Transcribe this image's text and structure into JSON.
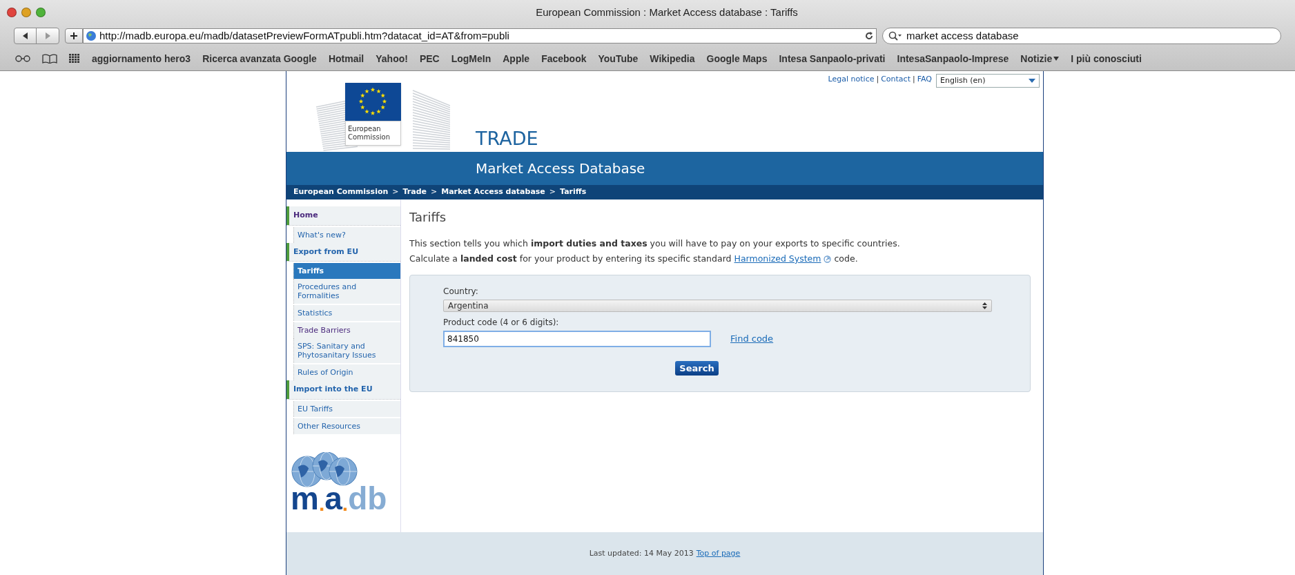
{
  "browser": {
    "title": "European Commission : Market Access database : Tariffs",
    "url": "http://madb.europa.eu/madb/datasetPreviewFormATpubli.htm?datacat_id=AT&from=publi",
    "search": "market access database",
    "bookmarks": [
      {
        "label": "aggiornamento hero3",
        "menu": false
      },
      {
        "label": "Ricerca avanzata Google",
        "menu": false
      },
      {
        "label": "Hotmail",
        "menu": false
      },
      {
        "label": "Yahoo!",
        "menu": false
      },
      {
        "label": "PEC",
        "menu": false
      },
      {
        "label": "LogMeIn",
        "menu": false
      },
      {
        "label": "Apple",
        "menu": false
      },
      {
        "label": "Facebook",
        "menu": false
      },
      {
        "label": "YouTube",
        "menu": false
      },
      {
        "label": "Wikipedia",
        "menu": false
      },
      {
        "label": "Google Maps",
        "menu": false
      },
      {
        "label": "Intesa Sanpaolo-privati",
        "menu": false
      },
      {
        "label": "IntesaSanpaolo-Imprese",
        "menu": false
      },
      {
        "label": "Notizie",
        "menu": true
      },
      {
        "label": "I più conosciuti",
        "menu": false
      }
    ]
  },
  "header": {
    "top_links": [
      "Legal notice",
      "Contact",
      "FAQ"
    ],
    "link_separator": "|",
    "language": "English (en)",
    "logo_text": "European Commission",
    "section": "TRADE",
    "subtitle": "Market Access Database",
    "breadcrumb": [
      "European Commission",
      "Trade",
      "Market Access database",
      "Tariffs"
    ],
    "breadcrumb_separator": ">"
  },
  "sidebar": {
    "items": [
      {
        "label": "Home",
        "kind": "section",
        "selected": false,
        "visited": true
      },
      {
        "label": "What's new?",
        "kind": "item",
        "selected": false,
        "visited": false
      },
      {
        "label": "Export from EU",
        "kind": "section",
        "selected": false,
        "visited": false
      },
      {
        "label": "Tariffs",
        "kind": "item",
        "selected": true,
        "visited": false
      },
      {
        "label": "Procedures and Formalities",
        "kind": "item",
        "selected": false,
        "visited": false
      },
      {
        "label": "Statistics",
        "kind": "item",
        "selected": false,
        "visited": false
      },
      {
        "label": "Trade Barriers",
        "kind": "item",
        "selected": false,
        "visited": true
      },
      {
        "label": "SPS: Sanitary and Phytosanitary Issues",
        "kind": "item",
        "selected": false,
        "visited": false
      },
      {
        "label": "Rules of Origin",
        "kind": "item",
        "selected": false,
        "visited": false
      },
      {
        "label": "Import into the EU",
        "kind": "section",
        "selected": false,
        "visited": false
      },
      {
        "label": "EU Tariffs",
        "kind": "item",
        "selected": false,
        "visited": false
      },
      {
        "label": "Other Resources",
        "kind": "item",
        "selected": false,
        "visited": false
      }
    ],
    "logo": [
      {
        "text": "m",
        "kind": "dark"
      },
      {
        "text": ".",
        "kind": "dot"
      },
      {
        "text": "a",
        "kind": "dark"
      },
      {
        "text": ".",
        "kind": "dot"
      },
      {
        "text": "db",
        "kind": "light"
      }
    ]
  },
  "content": {
    "title": "Tariffs",
    "intro": "This section tells you which **import duties and taxes** you will have to pay on your exports to specific countries.",
    "intro2_before": "Calculate a **landed cost** for your product by entering its specific standard",
    "intro2_link": "Harmonized System",
    "intro2_after": "code.",
    "country_label": "Country:",
    "country": "Argentina",
    "code_label": "Product code (4 or 6 digits):",
    "code": "841850",
    "find_code": "Find code",
    "search_button": "Search"
  },
  "footer": {
    "text": "Last updated: 14 May 2013",
    "link": "Top of page"
  }
}
